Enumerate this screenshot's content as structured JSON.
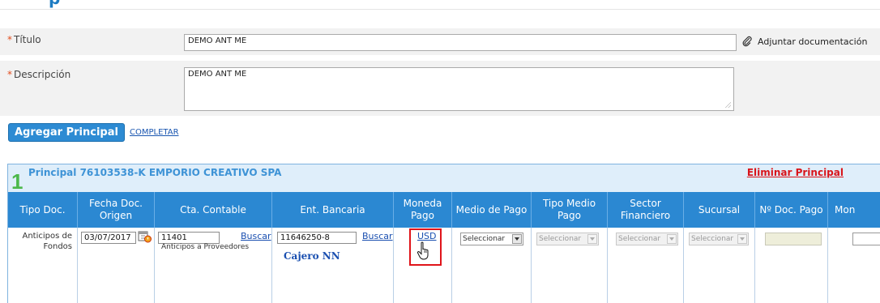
{
  "header": {
    "title_fragment": "p"
  },
  "form": {
    "titulo": {
      "label": "Título",
      "value": "DEMO ANT ME"
    },
    "descripcion": {
      "label": "Descripción",
      "value": "DEMO ANT ME"
    },
    "attach_label": "Adjuntar documentación",
    "required_mark": "*"
  },
  "actions": {
    "add_principal": "Agregar Principal",
    "completar": "COMPLETAR"
  },
  "principal": {
    "number": "1",
    "title": "Principal 76103538-K EMPORIO CREATIVO SPA",
    "delete_label": "Eliminar Principal",
    "columns": [
      "Tipo Doc.",
      "Fecha Doc. Origen",
      "Cta. Contable",
      "Ent. Bancaria",
      "Moneda Pago",
      "Medio de Pago",
      "Tipo Medio Pago",
      "Sector Financiero",
      "Sucursal",
      "Nº Doc. Pago",
      "Mon"
    ],
    "row": {
      "tipo_doc": "Anticipos de Fondos",
      "fecha": "03/07/2017",
      "cta_value": "11401",
      "cta_buscar": "Buscar",
      "cta_desc": "Anticipos a Proveedores",
      "ent_value": "11646250-8",
      "ent_buscar": "Buscar",
      "ent_desc": "Cajero NN",
      "moneda": "USD",
      "medio_pago": "Seleccionar",
      "tipo_medio": "Seleccionar",
      "sector": "Seleccionar",
      "sucursal": "Seleccionar"
    }
  },
  "colors": {
    "accent": "#2b88d2",
    "highlight_box": "#e0141a",
    "success": "#4cb84a"
  }
}
